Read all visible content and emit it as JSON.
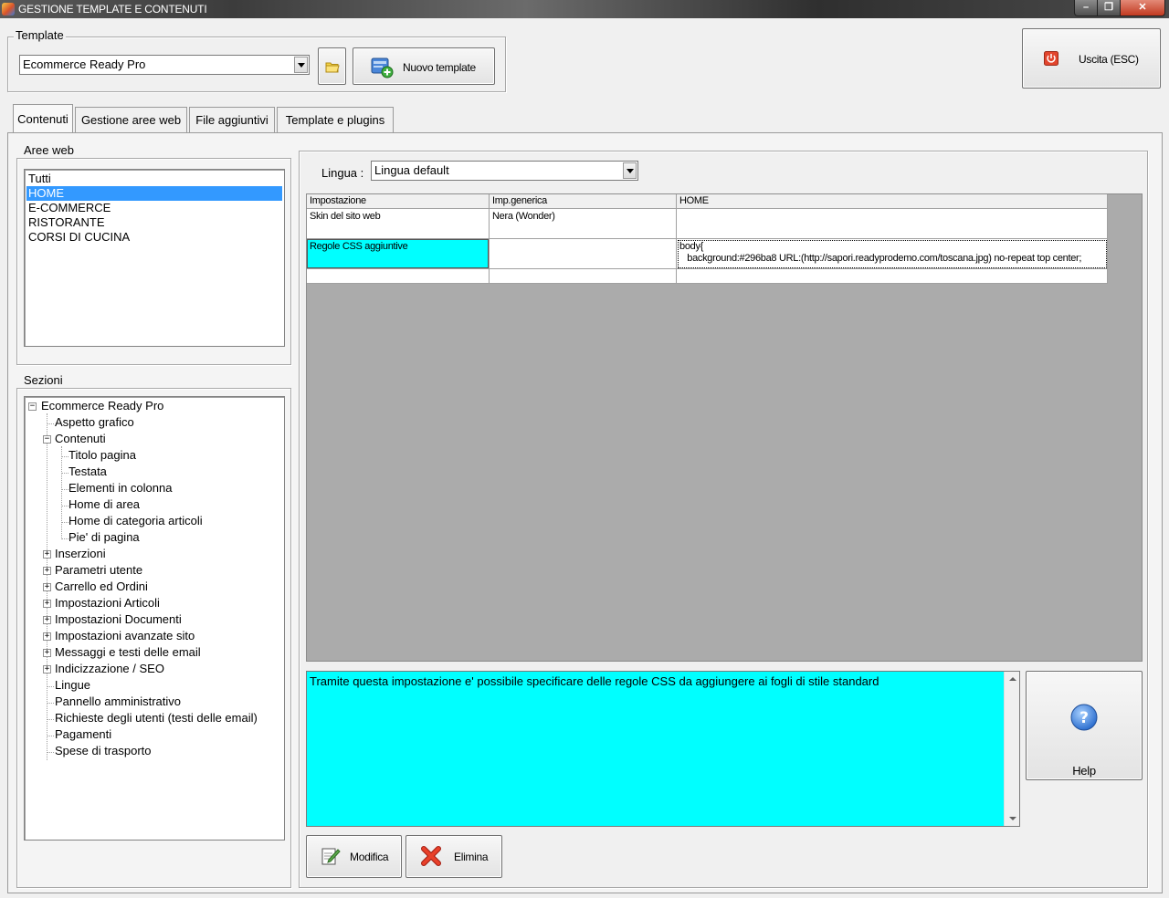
{
  "window": {
    "title": "GESTIONE TEMPLATE E CONTENUTI",
    "controls": {
      "minimize": "–",
      "maximize": "❐",
      "close": "✕"
    }
  },
  "template_group": {
    "label": "Template",
    "selected": "Ecommerce Ready Pro",
    "new_template_label": "Nuovo template"
  },
  "exit_button": {
    "label": "Uscita (ESC)"
  },
  "tabs": [
    {
      "label": "Contenuti",
      "active": true
    },
    {
      "label": "Gestione aree web",
      "active": false
    },
    {
      "label": "File aggiuntivi",
      "active": false
    },
    {
      "label": "Template e plugins",
      "active": false
    }
  ],
  "aree_web": {
    "label": "Aree web",
    "items": [
      "Tutti",
      "HOME",
      "E-COMMERCE",
      "RISTORANTE",
      "CORSI DI CUCINA"
    ],
    "selected": "HOME"
  },
  "sezioni": {
    "label": "Sezioni",
    "root": "Ecommerce Ready Pro",
    "items": [
      "Aspetto grafico",
      "Contenuti",
      "Titolo pagina",
      "Testata",
      "Elementi in colonna",
      "Home di area",
      "Home di categoria articoli",
      "Pie' di pagina",
      "Inserzioni",
      "Parametri utente",
      "Carrello ed Ordini",
      "Impostazioni Articoli",
      "Impostazioni Documenti",
      "Impostazioni avanzate sito",
      "Messaggi e testi delle email",
      "Indicizzazione / SEO",
      "Lingue",
      "Pannello amministrativo",
      "Richieste degli utenti (testi delle email)",
      "Pagamenti",
      "Spese di trasporto"
    ]
  },
  "lingua": {
    "label": "Lingua :",
    "selected": "Lingua default"
  },
  "grid": {
    "headers": [
      "Impostazione",
      "Imp.generica",
      "HOME"
    ],
    "rows": [
      [
        "Skin del sito web",
        "Nera (Wonder)",
        ""
      ],
      [
        "Regole CSS aggiuntive",
        "",
        "body{\n   background:#296ba8 URL:(http://sapori.readyprodemo.com/toscana.jpg) no-repeat top center;"
      ],
      [
        "",
        "",
        ""
      ]
    ],
    "highlight_color": "#00ffff"
  },
  "description": "Tramite questa impostazione e' possibile specificare delle regole CSS da aggiungere ai fogli di stile standard",
  "buttons": {
    "help": "Help",
    "modifica": "Modifica",
    "elimina": "Elimina"
  },
  "colors": {
    "selection": "#3399ff",
    "cyan": "#00ffff",
    "grid_background": "#ababab"
  }
}
